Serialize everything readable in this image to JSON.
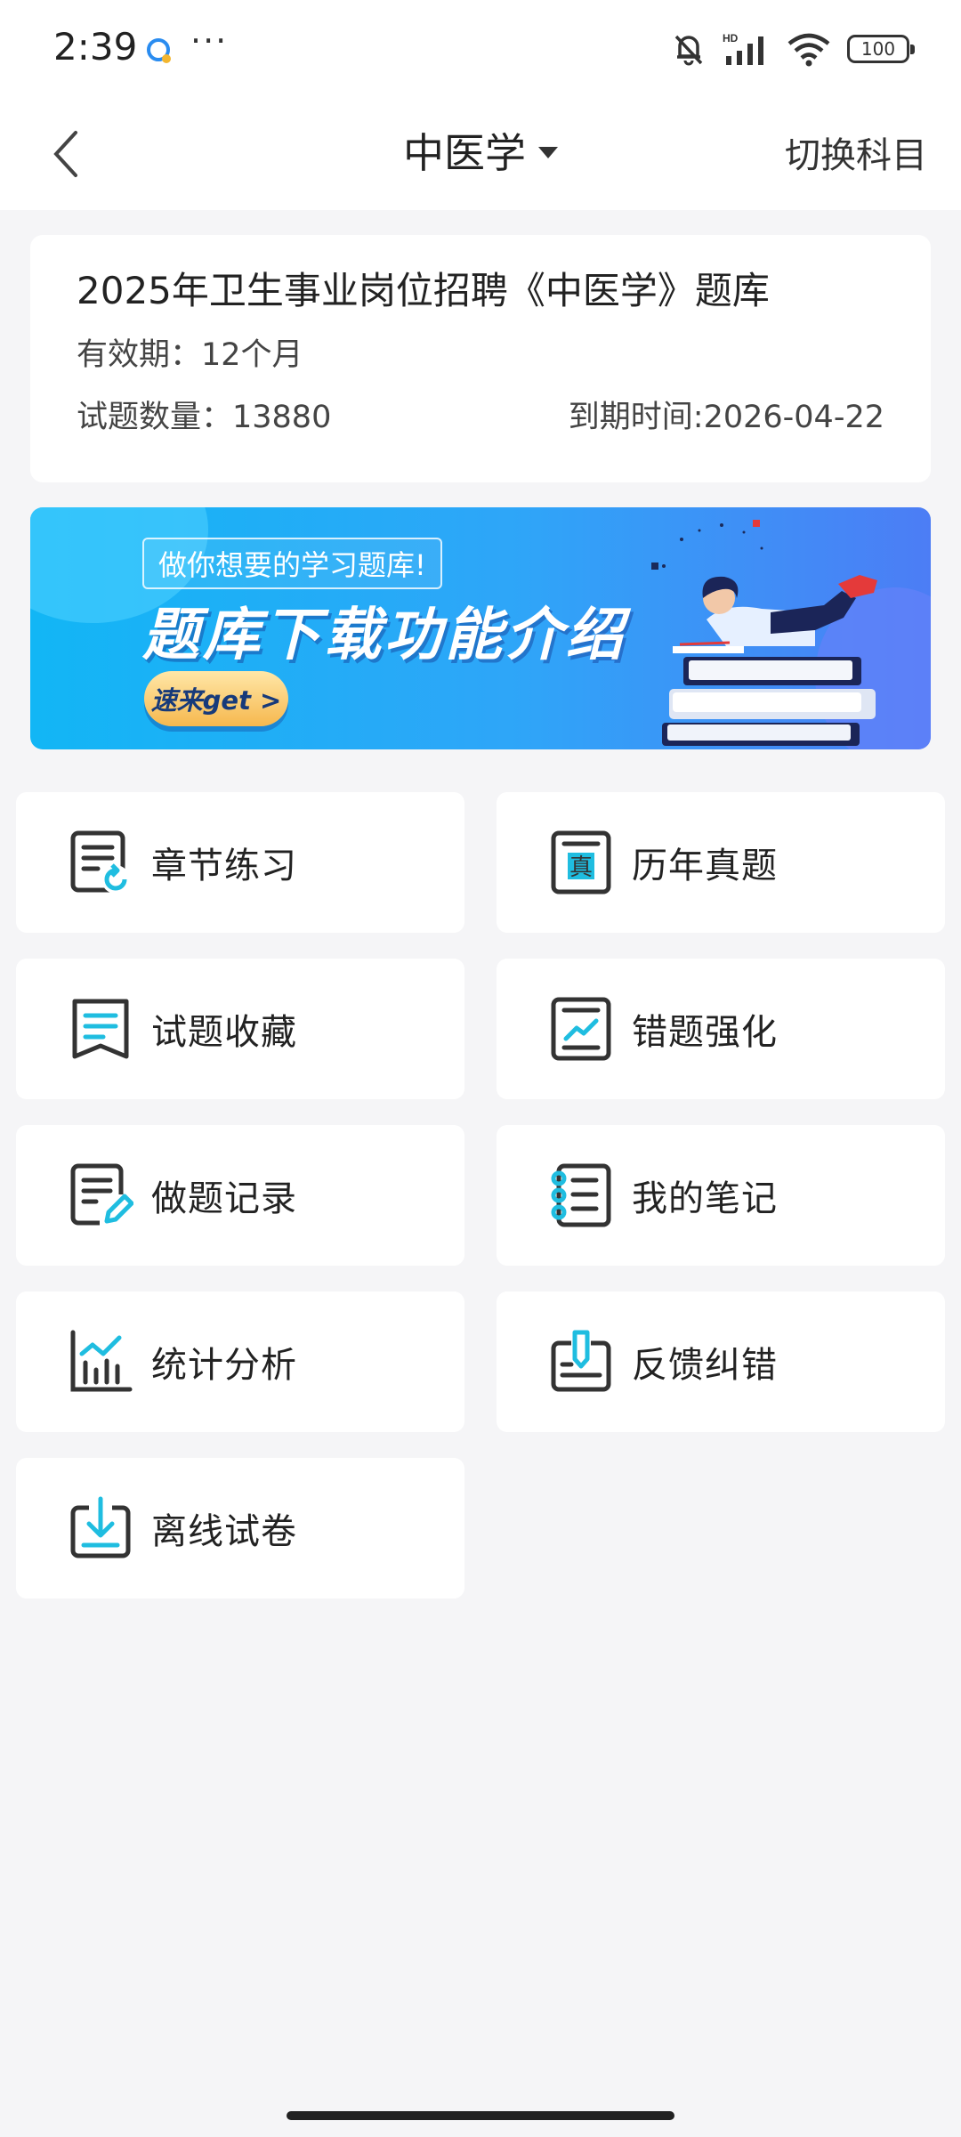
{
  "status_bar": {
    "time": "2:39",
    "more": "···",
    "battery": "100",
    "icons": [
      "notification-app-icon",
      "mute-icon",
      "hd-signal-icon",
      "wifi-icon",
      "battery-icon"
    ]
  },
  "header": {
    "title": "中医学",
    "switch_label": "切换科目"
  },
  "info": {
    "title": "2025年卫生事业岗位招聘《中医学》题库",
    "validity": "有效期：12个月",
    "question_count": "试题数量：13880",
    "expire": "到期时间:2026-04-22"
  },
  "banner": {
    "tag": "做你想要的学习题库!",
    "headline": "题库下载功能介绍",
    "cta": "速来get >"
  },
  "menu": [
    {
      "label": "章节练习",
      "icon": "chapter-practice-icon"
    },
    {
      "label": "历年真题",
      "icon": "past-exam-icon"
    },
    {
      "label": "试题收藏",
      "icon": "favorites-icon"
    },
    {
      "label": "错题强化",
      "icon": "wrong-questions-icon"
    },
    {
      "label": "做题记录",
      "icon": "practice-record-icon"
    },
    {
      "label": "我的笔记",
      "icon": "notes-icon"
    },
    {
      "label": "统计分析",
      "icon": "statistics-icon"
    },
    {
      "label": "反馈纠错",
      "icon": "feedback-icon"
    },
    {
      "label": "离线试卷",
      "icon": "offline-download-icon"
    }
  ],
  "colors": {
    "accent": "#1fbde0",
    "icon_stroke": "#333333",
    "banner_start": "#12b6f5",
    "banner_end": "#4c7df5"
  }
}
